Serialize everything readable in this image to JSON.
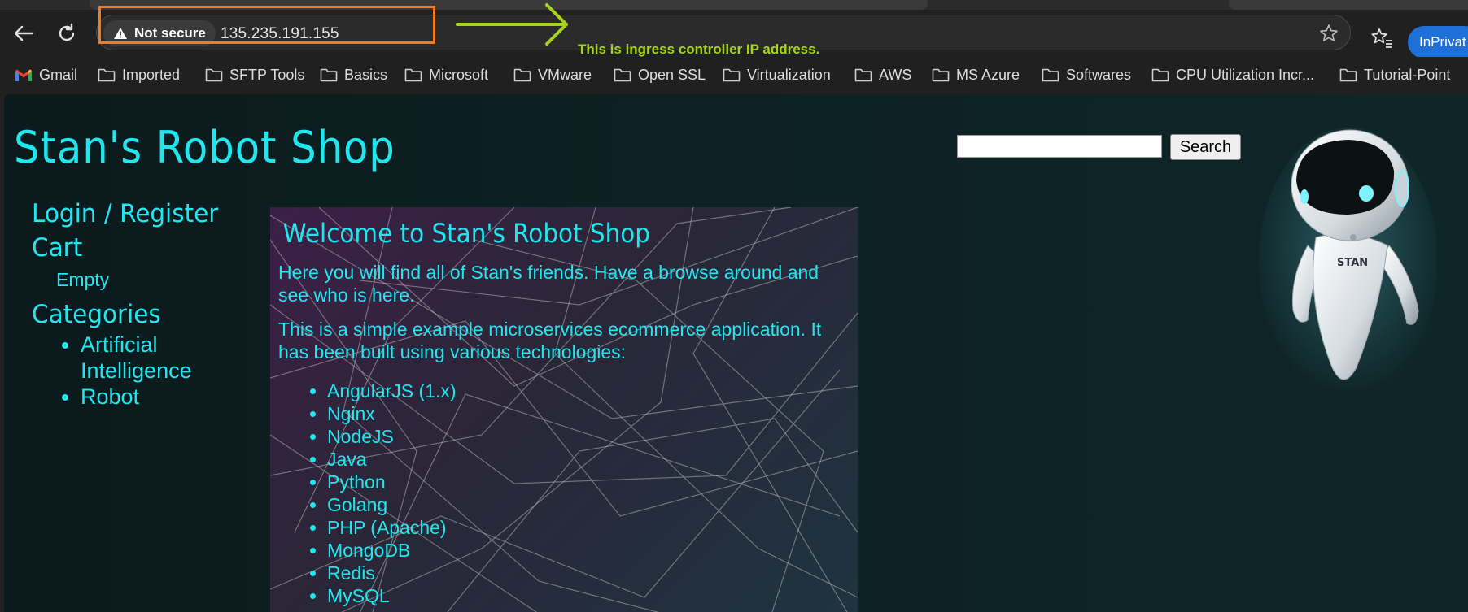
{
  "browser": {
    "security_label": "Not secure",
    "url": "135.235.191.155",
    "annotation": "This is ingress controller IP address.",
    "inprivate_label": "InPrivat"
  },
  "bookmarks": [
    {
      "label": "Gmail",
      "icon": "gmail-icon"
    },
    {
      "label": "Imported",
      "icon": "folder-icon"
    },
    {
      "label": "SFTP Tools",
      "icon": "folder-icon"
    },
    {
      "label": "Basics",
      "icon": "folder-icon"
    },
    {
      "label": "Microsoft",
      "icon": "folder-icon"
    },
    {
      "label": "VMware",
      "icon": "folder-icon"
    },
    {
      "label": "Open SSL",
      "icon": "folder-icon"
    },
    {
      "label": "Virtualization",
      "icon": "folder-icon"
    },
    {
      "label": "AWS",
      "icon": "folder-icon"
    },
    {
      "label": "MS Azure",
      "icon": "folder-icon"
    },
    {
      "label": "Softwares",
      "icon": "folder-icon"
    },
    {
      "label": "CPU Utilization Incr...",
      "icon": "folder-icon"
    },
    {
      "label": "Tutorial-Point",
      "icon": "folder-icon"
    }
  ],
  "page": {
    "title": "Stan's Robot Shop",
    "search_value": "",
    "search_button": "Search",
    "sidebar": {
      "login_register": "Login / Register",
      "cart_header": "Cart",
      "cart_status": "Empty",
      "categories_header": "Categories",
      "categories": [
        "Artificial Intelligence",
        "Robot"
      ]
    },
    "main": {
      "heading": "Welcome to Stan's Robot Shop",
      "intro": "Here you will find all of Stan's friends. Have a browse around and see who is here.",
      "description": "This is a simple example microservices ecommerce application. It has been built using various technologies:",
      "technologies": [
        "AngularJS (1.x)",
        "Nginx",
        "NodeJS",
        "Java",
        "Python",
        "Golang",
        "PHP (Apache)",
        "MongoDB",
        "Redis",
        "MySQL"
      ]
    },
    "robot_label": "STAN"
  },
  "colors": {
    "accent": "#22e6ee",
    "highlight_box": "#f07b22",
    "annotation": "#a6d41c",
    "inprivate": "#1f6fd8"
  }
}
